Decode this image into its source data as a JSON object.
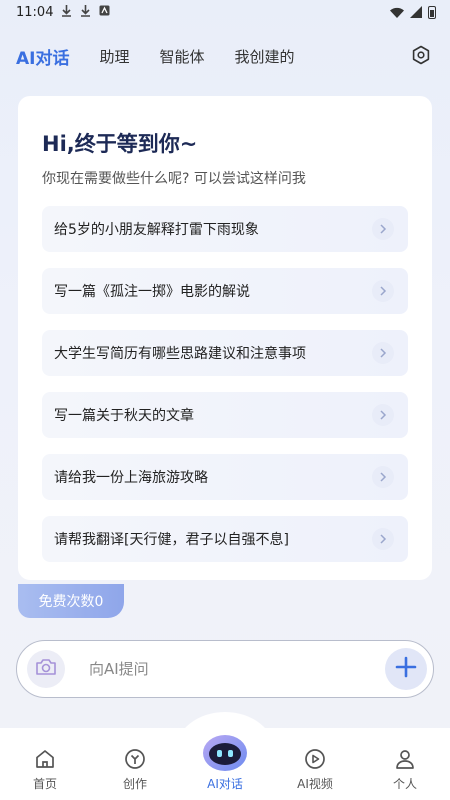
{
  "status_bar": {
    "time": "11:04"
  },
  "top_tabs": [
    {
      "label": "AI对话",
      "active": true
    },
    {
      "label": "助理",
      "active": false
    },
    {
      "label": "智能体",
      "active": false
    },
    {
      "label": "我创建的",
      "active": false
    }
  ],
  "card": {
    "greeting": "Hi,终于等到你~",
    "subtitle": "你现在需要做些什么呢? 可以尝试这样问我",
    "suggestions": [
      "给5岁的小朋友解释打雷下雨现象",
      "写一篇《孤注一掷》电影的解说",
      "大学生写简历有哪些思路建议和注意事项",
      "写一篇关于秋天的文章",
      "请给我一份上海旅游攻略",
      "请帮我翻译[天行健，君子以自强不息]"
    ]
  },
  "free_badge": "免费次数0",
  "input": {
    "placeholder": "向AI提问",
    "value": ""
  },
  "bottom_nav": [
    {
      "label": "首页",
      "icon": "home-icon",
      "active": false
    },
    {
      "label": "创作",
      "icon": "create-icon",
      "active": false
    },
    {
      "label": "AI对话",
      "icon": "robot-icon",
      "active": true
    },
    {
      "label": "AI视频",
      "icon": "video-icon",
      "active": false
    },
    {
      "label": "个人",
      "icon": "profile-icon",
      "active": false
    }
  ],
  "colors": {
    "accent": "#3a6fe0",
    "greeting": "#1d2a56",
    "badge": "#98aeec"
  }
}
